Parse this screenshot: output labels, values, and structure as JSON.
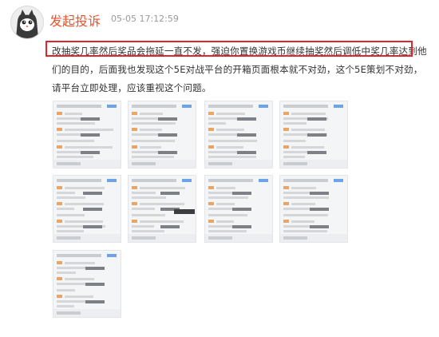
{
  "post": {
    "username": "发起投诉",
    "timestamp": "05-05 17:12:59",
    "text": "改抽奖几率然后奖品会拖延一直不发，强迫你置换游戏币继续抽奖然后调低中奖几率达到他们的目的，后面我也发现这个5E对战平台的开箱页面根本就不对劲，这个5E策划不对劲，请平台立即处理，应该重视这个问题。"
  },
  "attachments": {
    "count": 9,
    "thumbnails": [
      {
        "label": "",
        "icon": "screenshot-thumbnail"
      },
      {
        "label": "",
        "icon": "screenshot-thumbnail"
      },
      {
        "label": "",
        "icon": "screenshot-thumbnail"
      },
      {
        "label": "",
        "icon": "screenshot-thumbnail"
      },
      {
        "label": "",
        "icon": "screenshot-thumbnail"
      },
      {
        "label": "",
        "icon": "screenshot-thumbnail"
      },
      {
        "label": "",
        "icon": "screenshot-thumbnail"
      },
      {
        "label": "",
        "icon": "screenshot-thumbnail"
      },
      {
        "label": "",
        "icon": "screenshot-thumbnail"
      }
    ]
  },
  "colors": {
    "username": "#e8542f",
    "highlight_border": "#e0252c",
    "timestamp": "#9a9a9a",
    "text": "#333333"
  }
}
